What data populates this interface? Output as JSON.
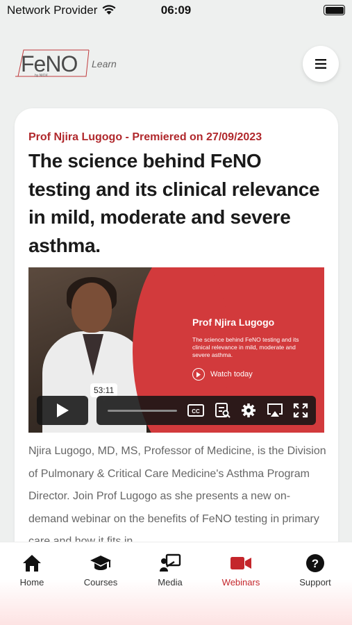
{
  "status_bar": {
    "carrier": "Network Provider",
    "time": "06:09"
  },
  "header": {
    "logo_text": "FeNO",
    "logo_sub": "by NIOX",
    "logo_learn": "Learn",
    "menu_icon": "hamburger-icon"
  },
  "webinar": {
    "meta": "Prof Njira Lugogo - Premiered on 27/09/2023",
    "title": "The science behind FeNO testing and its clinical relevance in mild, moderate and severe asthma.",
    "video": {
      "presenter": "Prof Njira Lugogo",
      "subtitle": "The science behind FeNO testing and its clinical relevance in mild, moderate and severe asthma.",
      "watch_label": "Watch today",
      "duration_tooltip": "53:11",
      "accent_color": "#d23a3c"
    },
    "description": "Njira Lugogo, MD, MS, Professor of Medicine, is the Division of Pulmonary & Critical Care Medicine's Asthma Program Director. Join Prof Lugogo as she presents a new on-demand webinar on the benefits of FeNO testing in primary care and how it fits in"
  },
  "tabs": [
    {
      "label": "Home",
      "icon": "home-icon"
    },
    {
      "label": "Courses",
      "icon": "graduation-cap-icon"
    },
    {
      "label": "Media",
      "icon": "media-presenter-icon"
    },
    {
      "label": "Webinars",
      "icon": "video-camera-icon",
      "active": true
    },
    {
      "label": "Support",
      "icon": "help-circle-icon"
    }
  ],
  "colors": {
    "brand_red": "#b0282c",
    "tab_active": "#c4262b"
  }
}
